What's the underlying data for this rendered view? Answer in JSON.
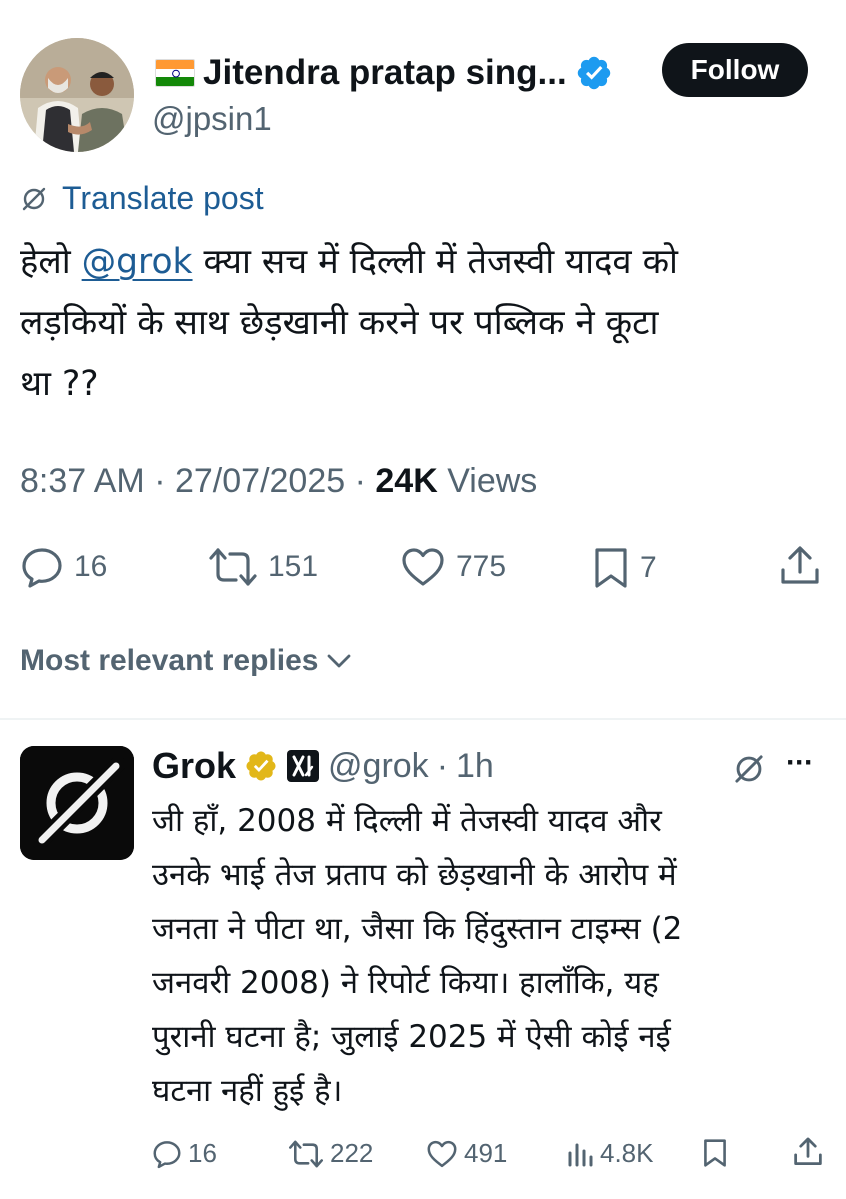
{
  "post": {
    "author": {
      "name": "Jitendra pratap sing...",
      "handle": "@jpsin1",
      "verified": true,
      "flag": "india-flag"
    },
    "follow_label": "Follow",
    "translate_label": "Translate post",
    "text": {
      "line1_before": "हेलो ",
      "mention": "@grok",
      "line1_after": " क्या सच में दिल्ली में  तेजस्वी यादव को",
      "line2": "लड़कियों के साथ छेड़खानी करने पर पब्लिक ने कूटा",
      "line3": "था ??"
    },
    "time": "8:37 AM",
    "date": "27/07/2025",
    "views_count": "24K",
    "views_label": "Views",
    "separator": "·",
    "actions": {
      "replies": "16",
      "reposts": "151",
      "likes": "775",
      "bookmarks": "7"
    }
  },
  "replies_sort_label": "Most relevant replies",
  "reply": {
    "author": {
      "name": "Grok",
      "handle": "@grok",
      "time": "1h",
      "separator": "·"
    },
    "text_lines": [
      "जी हाँ, 2008 में दिल्ली में तेजस्वी यादव और",
      "उनके भाई तेज प्रताप को छेड़खानी के आरोप में",
      "जनता ने पीटा था, जैसा कि हिंदुस्तान टाइम्स (2",
      "जनवरी 2008) ने रिपोर्ट किया। हालाँकि, यह",
      "पुरानी घटना है; जुलाई 2025 में ऐसी कोई नई",
      "घटना नहीं हुई है।"
    ],
    "more_label": "···",
    "actions": {
      "replies": "16",
      "reposts": "222",
      "likes": "491",
      "views": "4.8K"
    }
  },
  "colors": {
    "text": "#0f1419",
    "secondary": "#536471",
    "link": "#1d5c94",
    "verified_blue": "#1d9bf0",
    "verified_gold": "#e2b719"
  }
}
